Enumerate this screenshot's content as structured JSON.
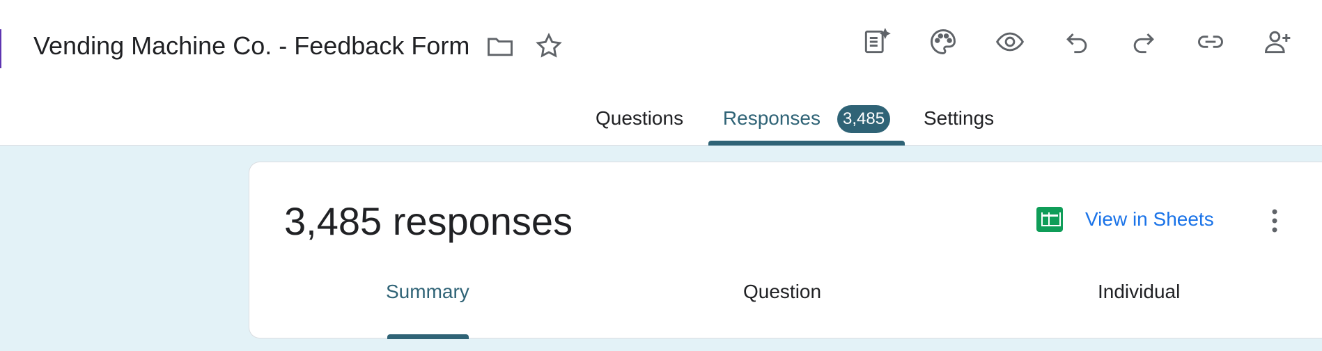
{
  "header": {
    "title": "Vending Machine Co. - Feedback Form",
    "title_icons": [
      "folder-icon",
      "star-icon"
    ],
    "toolbar": [
      "customize-form-icon",
      "palette-icon",
      "preview-eye-icon",
      "undo-icon",
      "redo-icon",
      "link-icon",
      "add-collaborator-icon"
    ]
  },
  "tabs": [
    {
      "label": "Questions",
      "active": false
    },
    {
      "label": "Responses",
      "active": true,
      "badge": "3,485"
    },
    {
      "label": "Settings",
      "active": false
    }
  ],
  "responses_card": {
    "count_text": "3,485 responses",
    "view_in_sheets": "View in Sheets",
    "more_icon": "more-vertical-icon",
    "subtabs": [
      {
        "label": "Summary",
        "active": true
      },
      {
        "label": "Question",
        "active": false
      },
      {
        "label": "Individual",
        "active": false
      }
    ]
  },
  "colors": {
    "accent": "#2f6376",
    "background": "#e3f2f7",
    "link": "#1a73e8",
    "sheets_green": "#0f9d58",
    "side_accent": "#5e35b1"
  }
}
